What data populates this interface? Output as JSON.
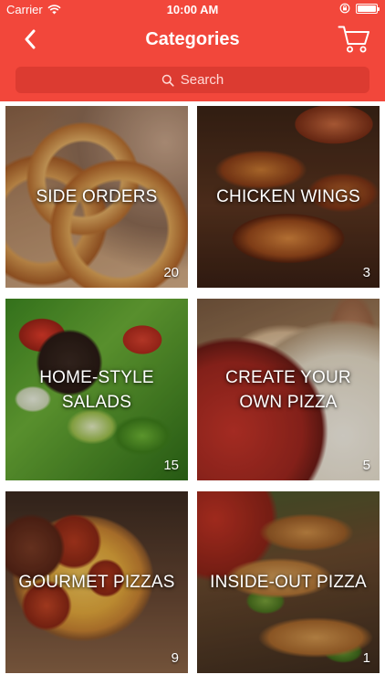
{
  "status_bar": {
    "carrier": "Carrier",
    "time": "10:00 AM",
    "battery_level": 1.0
  },
  "nav": {
    "title": "Categories",
    "back_icon": "chevron-left-icon",
    "cart_icon": "shopping-cart-icon"
  },
  "search": {
    "placeholder": "Search",
    "icon": "search-icon"
  },
  "categories": [
    {
      "label": "SIDE ORDERS",
      "count": "20"
    },
    {
      "label": "CHICKEN WINGS",
      "count": "3"
    },
    {
      "label": "HOME-STYLE\nSALADS",
      "count": "15"
    },
    {
      "label": "CREATE YOUR\nOWN PIZZA",
      "count": "5"
    },
    {
      "label": "GOURMET PIZZAS",
      "count": "9"
    },
    {
      "label": "INSIDE-OUT PIZZA",
      "count": "1"
    }
  ],
  "colors": {
    "header": "#f2473b",
    "search_bg": "#dc3b31"
  }
}
